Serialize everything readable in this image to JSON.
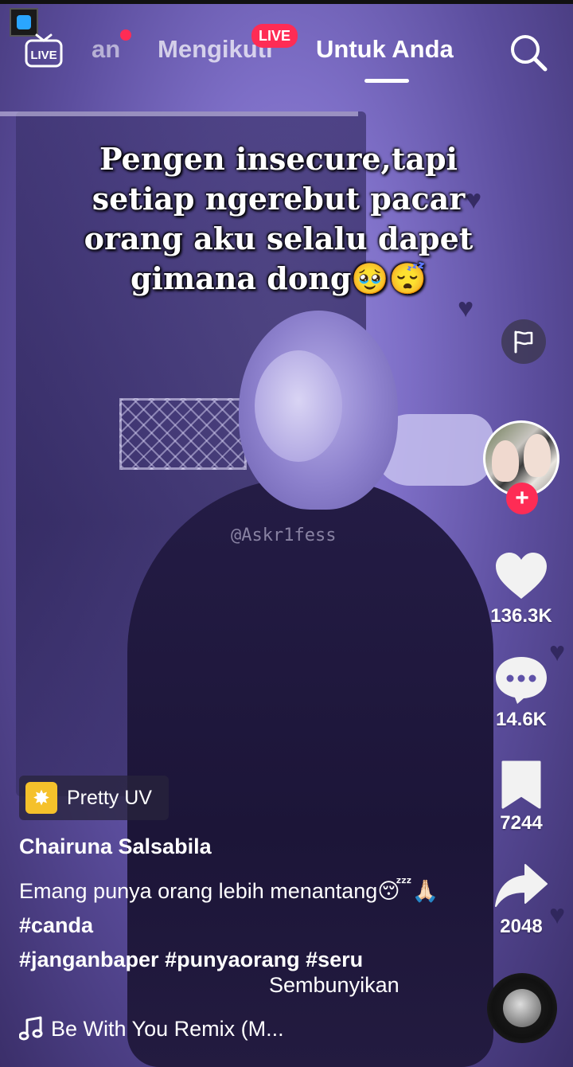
{
  "top_nav": {
    "live_label": "LIVE",
    "partial_tab": "an",
    "following_tab": "Mengikuti",
    "live_badge": "LIVE",
    "for_you_tab": "Untuk Anda"
  },
  "video": {
    "caption_line1": "Pengen insecure,tapi",
    "caption_line2": "setiap ngerebut pacar",
    "caption_line3": "orang aku selalu dapet",
    "caption_line4": "gimana dong🥹😴",
    "watermark": "@Askr1fess"
  },
  "right_rail": {
    "likes": "136.3K",
    "comments": "14.6K",
    "bookmarks": "7244",
    "shares": "2048",
    "follow_symbol": "+"
  },
  "post": {
    "effect_label": "Pretty UV",
    "username": "Chairuna Salsabila",
    "description_text": "Emang punya orang lebih menantang😴🙏🏻",
    "hashtags": [
      "#canda",
      "#janganbaper",
      "#punyaorang",
      "#seru"
    ],
    "hide_label": "Sembunyikan",
    "music_title": "Be With You Remix (M..."
  },
  "colors": {
    "accent_red": "#fe2c55",
    "effect_yellow": "#f5c12b",
    "tint_purple": "#7d6ec6"
  },
  "icons": {
    "live": "tv-live-icon",
    "search": "search-icon",
    "flag": "flag-icon",
    "like": "heart-icon",
    "comment": "comment-bubble-icon",
    "bookmark": "bookmark-icon",
    "share": "share-arrow-icon",
    "music": "music-note-icon"
  }
}
